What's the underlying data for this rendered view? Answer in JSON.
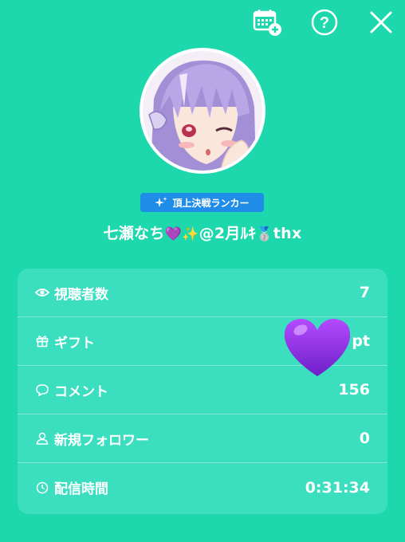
{
  "toolbar": {
    "calendar_icon": "calendar-add-icon",
    "help_label": "?",
    "close_icon": "close-icon"
  },
  "profile": {
    "badge_label": "頂上決戦ランカー",
    "name_text": "七瀬なち",
    "name_emojis": "💜✨",
    "name_suffix": "@2月ﾙｷ",
    "name_medal": "🥈",
    "name_end": "thx"
  },
  "stats": [
    {
      "label": "視聴者数",
      "value": "7",
      "icon": "eye-icon"
    },
    {
      "label": "ギフト",
      "value": "pt",
      "icon": "gift-icon"
    },
    {
      "label": "コメント",
      "value": "156",
      "icon": "comment-icon"
    },
    {
      "label": "新規フォロワー",
      "value": "0",
      "icon": "person-icon"
    },
    {
      "label": "配信時間",
      "value": "0:31:34",
      "icon": "clock-icon"
    }
  ],
  "colors": {
    "background": "#1ed8ad",
    "panel": "#3bdfc0",
    "badge": "#1f8de8",
    "heart": "#8a2be2"
  }
}
